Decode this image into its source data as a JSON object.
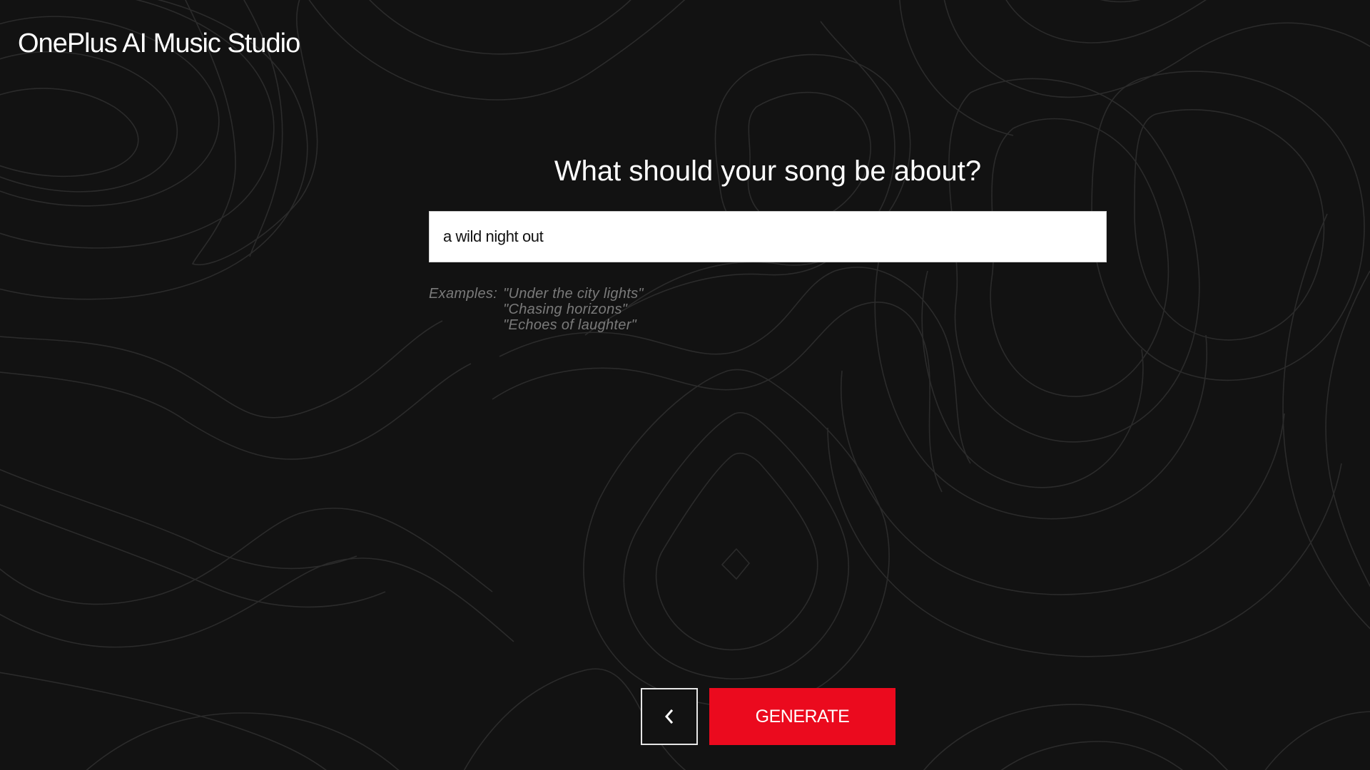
{
  "app": {
    "title": "OnePlus AI Music Studio"
  },
  "prompt": {
    "question": "What should your song be about?",
    "input_value": "a wild night out"
  },
  "examples": {
    "label": "Examples:",
    "items": [
      "\"Under the city lights\"",
      "\"Chasing horizons\"",
      "\"Echoes of laughter\""
    ]
  },
  "actions": {
    "back_icon": "chevron-left-icon",
    "generate_label": "GENERATE"
  },
  "colors": {
    "background": "#121212",
    "accent": "#eb0a1e",
    "contour_lines": "#2b2b2b"
  }
}
